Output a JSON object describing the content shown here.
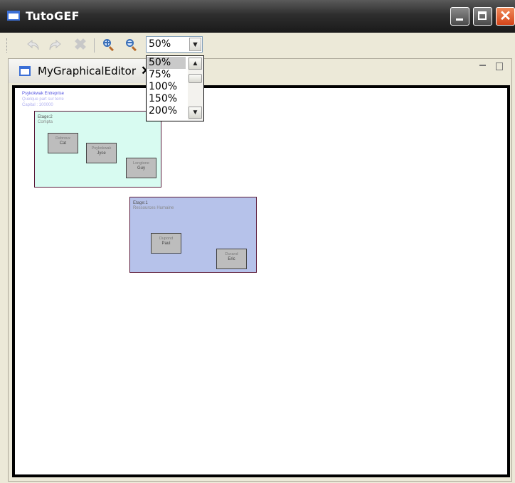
{
  "window": {
    "title": "TutoGEF",
    "close_glyph": "✕"
  },
  "toolbar": {
    "undo_icon": "undo-icon",
    "redo_icon": "redo-icon",
    "delete_glyph": "✖",
    "zoom_value": "50%",
    "zoom_arrow": "▼"
  },
  "editor": {
    "tab_label": "MyGraphicalEditor",
    "tab_close_glyph": "✕"
  },
  "zoom_dropdown": {
    "options": [
      "50%",
      "75%",
      "100%",
      "150%",
      "200%"
    ],
    "selected": "50%",
    "up_arrow": "▲",
    "down_arrow": "▼"
  },
  "diagram": {
    "entreprise": {
      "nom": "Psykokwak Entreprise",
      "adresse": "Quelque part sur terre",
      "capital": "Capital : 100000"
    },
    "services": [
      {
        "etage": "Etage:2",
        "nom": "Compta",
        "employes": [
          {
            "nom": "Debroux",
            "prenom": "Cat"
          },
          {
            "nom": "Psykokwak",
            "prenom": "Jyce"
          },
          {
            "nom": "Longtone",
            "prenom": "Guy"
          }
        ]
      },
      {
        "etage": "Etage:1",
        "nom": "Ressources Humaine",
        "employes": [
          {
            "nom": "Dupond",
            "prenom": "Paul"
          },
          {
            "nom": "Durand",
            "prenom": "Eric"
          }
        ]
      }
    ]
  }
}
